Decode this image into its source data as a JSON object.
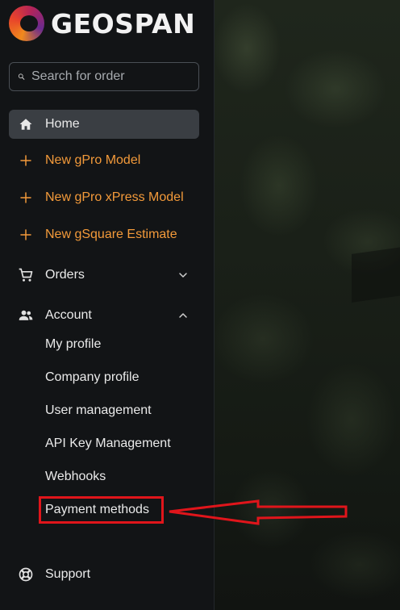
{
  "brand": {
    "name": "GEOSPAN"
  },
  "search": {
    "placeholder": "Search for order"
  },
  "nav": {
    "home": "Home",
    "new_gpro": "New gPro Model",
    "new_gpro_xpress": "New gPro xPress Model",
    "new_gsquare": "New gSquare Estimate",
    "orders": "Orders",
    "account": "Account",
    "account_items": [
      "My profile",
      "Company profile",
      "User management",
      "API Key Management",
      "Webhooks",
      "Payment methods"
    ],
    "support": "Support"
  },
  "colors": {
    "accent_orange": "#f39a3a",
    "active_bg": "#3a3e43",
    "annotation_red": "#e0151b"
  },
  "icons": {
    "home": "home-icon",
    "plus": "plus-icon",
    "orders": "cart-icon",
    "account": "people-icon",
    "support": "lifebuoy-icon",
    "search": "search-icon"
  }
}
